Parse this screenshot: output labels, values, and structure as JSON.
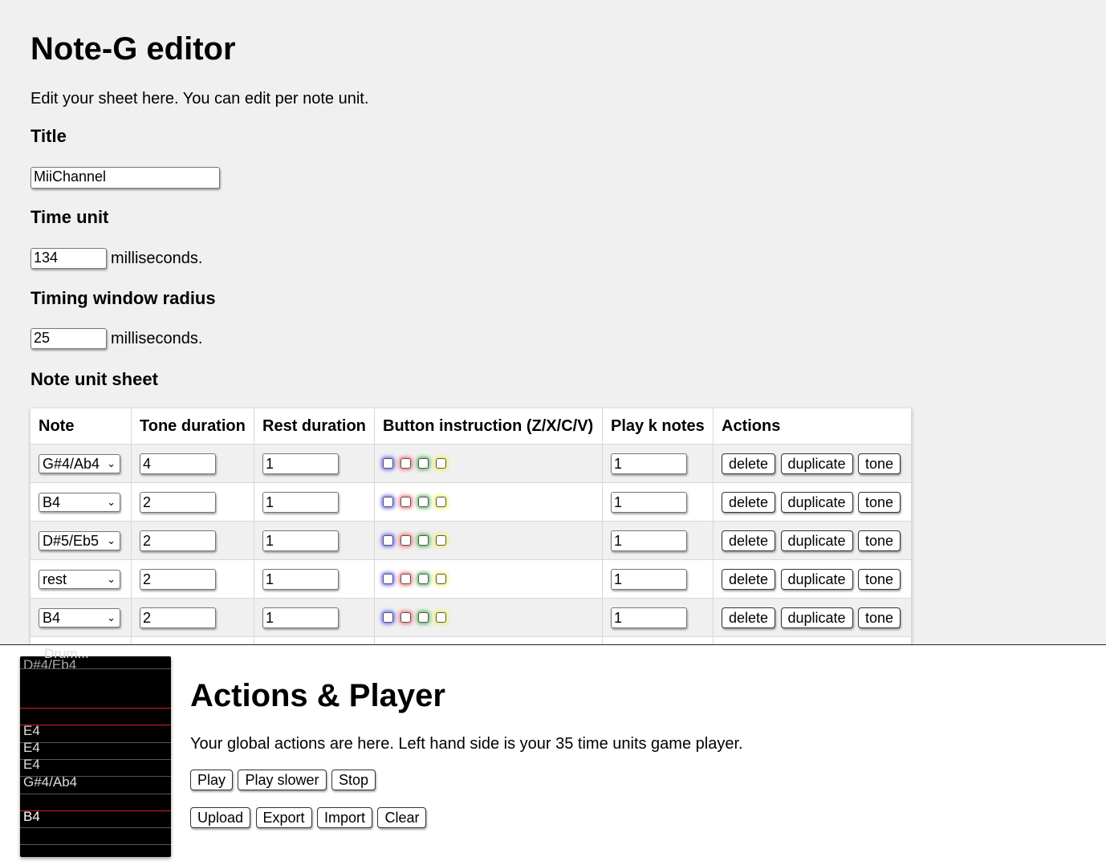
{
  "editor": {
    "title": "Note-G editor",
    "description": "Edit your sheet here. You can edit per note unit.",
    "title_label": "Title",
    "title_value": "MiiChannel",
    "time_unit_label": "Time unit",
    "time_unit_value": "134",
    "time_unit_suffix": "milliseconds.",
    "timing_window_label": "Timing window radius",
    "timing_window_value": "25",
    "timing_window_suffix": "milliseconds.",
    "sheet_label": "Note unit sheet"
  },
  "sheet": {
    "headers": [
      "Note",
      "Tone duration",
      "Rest duration",
      "Button instruction (Z/X/C/V)",
      "Play k notes",
      "Actions"
    ],
    "rows": [
      {
        "note": "G#4/Ab4",
        "tone": "4",
        "rest": "1",
        "k": "1"
      },
      {
        "note": "B4",
        "tone": "2",
        "rest": "1",
        "k": "1"
      },
      {
        "note": "D#5/Eb5",
        "tone": "2",
        "rest": "1",
        "k": "1"
      },
      {
        "note": "rest",
        "tone": "2",
        "rest": "1",
        "k": "1"
      },
      {
        "note": "B4",
        "tone": "2",
        "rest": "1",
        "k": "1"
      }
    ],
    "row_actions": {
      "delete": "delete",
      "duplicate": "duplicate",
      "tone": "tone"
    },
    "button_colors": {
      "z": "#5050ff",
      "x": "#ff5a5a",
      "c": "#3caa3c",
      "v": "#f0f050"
    }
  },
  "player": {
    "partial_title": "Drum...",
    "notes": [
      "D#4/Eb4",
      "E4",
      "E4",
      "E4",
      "G#4/Ab4",
      "B4"
    ],
    "background": "#000000",
    "line_red": "#d02020"
  },
  "actions": {
    "title": "Actions & Player",
    "description": "Your global actions are here. Left hand side is your 35 time units game player.",
    "play": "Play",
    "play_slower": "Play slower",
    "stop": "Stop",
    "upload": "Upload",
    "export": "Export",
    "import": "Import",
    "clear": "Clear"
  }
}
